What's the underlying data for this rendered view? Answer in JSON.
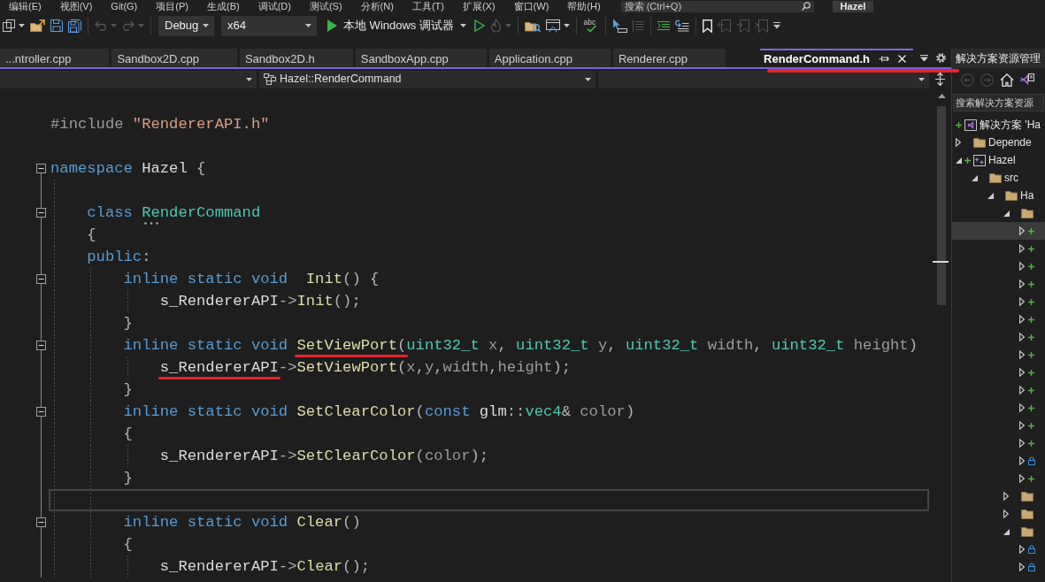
{
  "menu_bar": {
    "items": [
      "编辑(E)",
      "视图(V)",
      "Git(G)",
      "项目(P)",
      "生成(B)",
      "调试(D)",
      "测试(S)",
      "分析(N)",
      "工具(T)",
      "扩展(X)",
      "窗口(W)",
      "帮助(H)"
    ],
    "search": {
      "placeholder": "搜索 (Ctrl+Q)"
    },
    "solution_name": "Hazel"
  },
  "toolbar": [
    {
      "kind": "new",
      "disabled": false,
      "menu": true
    },
    {
      "kind": "open",
      "disabled": false,
      "menu": false
    },
    {
      "kind": "save",
      "disabled": false,
      "menu": false
    },
    {
      "kind": "save-all",
      "disabled": false,
      "menu": false
    },
    {
      "kind": "separator"
    },
    {
      "kind": "undo",
      "disabled": true,
      "menu": true
    },
    {
      "kind": "redo",
      "disabled": true,
      "menu": true
    },
    {
      "kind": "separator"
    },
    {
      "kind": "dropdown",
      "value": "Debug"
    },
    {
      "kind": "dropdown",
      "value": "x64"
    },
    {
      "kind": "run",
      "label": "本地 Windows 调试器",
      "menu": true
    },
    {
      "kind": "run-plain",
      "disabled": false,
      "menu": false
    },
    {
      "kind": "hot-reload",
      "disabled": true,
      "menu": true
    },
    {
      "kind": "separator"
    },
    {
      "kind": "find",
      "disabled": false,
      "menu": false
    },
    {
      "kind": "window",
      "disabled": false,
      "menu": true
    },
    {
      "kind": "separator"
    },
    {
      "kind": "spell",
      "text": "abc",
      "disabled": false,
      "menu": false
    },
    {
      "kind": "separator"
    },
    {
      "kind": "select",
      "disabled": false,
      "menu": false
    },
    {
      "kind": "lines",
      "disabled": true,
      "menu": false
    },
    {
      "kind": "separator"
    },
    {
      "kind": "indent",
      "disabled": false,
      "menu": false
    },
    {
      "kind": "wrap",
      "disabled": false,
      "menu": false
    },
    {
      "kind": "separator"
    },
    {
      "kind": "bookmark",
      "disabled": false,
      "menu": false
    },
    {
      "kind": "bookmark-prev",
      "disabled": true,
      "menu": false
    },
    {
      "kind": "bookmark-next",
      "disabled": true,
      "menu": false
    },
    {
      "kind": "bookmark-clear",
      "disabled": true,
      "menu": false
    },
    {
      "kind": "overflow"
    }
  ],
  "tabs": [
    {
      "label": "...ntroller.cpp",
      "selected": false,
      "underlined": false
    },
    {
      "label": "Sandbox2D.cpp",
      "selected": false,
      "underlined": false
    },
    {
      "label": "Sandbox2D.h",
      "selected": false,
      "underlined": false
    },
    {
      "label": "SandboxApp.cpp",
      "selected": false,
      "underlined": false
    },
    {
      "label": "Application.cpp",
      "selected": false,
      "underlined": false
    },
    {
      "label": "Renderer.cpp",
      "selected": false,
      "underlined": false
    },
    {
      "label": "RenderCommand.h",
      "selected": true,
      "underlined": true
    }
  ],
  "navigation_bar": {
    "class_dropdown": {
      "value": "Hazel::RenderCommand"
    }
  },
  "editor": {
    "lines": [
      {
        "collapsible": false,
        "current": false,
        "tokens": [
          {
            "kind": "preprocessor",
            "text": "#include "
          },
          {
            "kind": "string",
            "text": "\"RendererAPI.h\""
          }
        ]
      },
      {
        "collapsible": false,
        "current": false
      },
      {
        "collapsible": true,
        "current": false,
        "tokens": [
          {
            "kind": "keyword",
            "text": "namespace"
          },
          {
            "kind": "plain",
            "text": " Hazel "
          },
          {
            "kind": "punct",
            "text": "{"
          }
        ]
      },
      {
        "collapsible": false,
        "current": false
      },
      {
        "collapsible": true,
        "current": false,
        "tokens": [
          {
            "kind": "keyword",
            "text": "    class "
          },
          {
            "kind": "suggested",
            "text": "RenderCommand"
          }
        ]
      },
      {
        "collapsible": false,
        "current": false,
        "tokens": [
          {
            "kind": "punct",
            "text": "    {"
          }
        ]
      },
      {
        "collapsible": false,
        "current": false,
        "tokens": [
          {
            "kind": "keyword",
            "text": "    public"
          },
          {
            "kind": "punct",
            "text": ":"
          }
        ]
      },
      {
        "collapsible": true,
        "current": false,
        "tokens": [
          {
            "kind": "keyword",
            "text": "        inline static void  "
          },
          {
            "kind": "function",
            "text": "Init"
          },
          {
            "kind": "punct",
            "text": "() {"
          }
        ]
      },
      {
        "collapsible": false,
        "current": false,
        "tokens": [
          {
            "kind": "plain",
            "text": "            s_RendererAPI"
          },
          {
            "kind": "punct",
            "text": "->"
          },
          {
            "kind": "function",
            "text": "Init"
          },
          {
            "kind": "punct",
            "text": "();"
          }
        ]
      },
      {
        "collapsible": false,
        "current": false,
        "tokens": [
          {
            "kind": "punct",
            "text": "        }"
          }
        ]
      },
      {
        "collapsible": true,
        "current": false,
        "tokens": [
          {
            "kind": "keyword",
            "text": "        inline static void "
          },
          {
            "kind": "function",
            "text": "SetViewPort",
            "underlined": true
          },
          {
            "kind": "punct",
            "text": "(",
            "underlined": true
          },
          {
            "kind": "type",
            "text": "uint32_t"
          },
          {
            "kind": "param",
            "text": " x"
          },
          {
            "kind": "punct",
            "text": ", "
          },
          {
            "kind": "type",
            "text": "uint32_t"
          },
          {
            "kind": "param",
            "text": " y"
          },
          {
            "kind": "punct",
            "text": ", "
          },
          {
            "kind": "type",
            "text": "uint32_t"
          },
          {
            "kind": "param",
            "text": " width"
          },
          {
            "kind": "punct",
            "text": ", "
          },
          {
            "kind": "type",
            "text": "uint32_t"
          },
          {
            "kind": "param",
            "text": " height"
          },
          {
            "kind": "punct",
            "text": ")"
          }
        ]
      },
      {
        "collapsible": false,
        "current": false,
        "tokens": [
          {
            "kind": "plain",
            "text": "            s_RendererAPI",
            "underlined": true
          },
          {
            "kind": "punct",
            "text": "->"
          },
          {
            "kind": "function",
            "text": "SetViewPort"
          },
          {
            "kind": "punct",
            "text": "("
          },
          {
            "kind": "param",
            "text": "x"
          },
          {
            "kind": "punct",
            "text": ","
          },
          {
            "kind": "param",
            "text": "y"
          },
          {
            "kind": "punct",
            "text": ","
          },
          {
            "kind": "param",
            "text": "width"
          },
          {
            "kind": "punct",
            "text": ","
          },
          {
            "kind": "param",
            "text": "height"
          },
          {
            "kind": "punct",
            "text": ");"
          }
        ]
      },
      {
        "collapsible": false,
        "current": false,
        "tokens": [
          {
            "kind": "punct",
            "text": "        }"
          }
        ]
      },
      {
        "collapsible": true,
        "current": false,
        "tokens": [
          {
            "kind": "keyword",
            "text": "        inline static void "
          },
          {
            "kind": "function",
            "text": "SetClearColor"
          },
          {
            "kind": "punct",
            "text": "("
          },
          {
            "kind": "keyword",
            "text": "const"
          },
          {
            "kind": "plain",
            "text": " glm"
          },
          {
            "kind": "punct",
            "text": "::"
          },
          {
            "kind": "type",
            "text": "vec4"
          },
          {
            "kind": "punct",
            "text": "& "
          },
          {
            "kind": "param",
            "text": "color"
          },
          {
            "kind": "punct",
            "text": ")"
          }
        ]
      },
      {
        "collapsible": false,
        "current": false,
        "tokens": [
          {
            "kind": "punct",
            "text": "        {"
          }
        ]
      },
      {
        "collapsible": false,
        "current": false,
        "tokens": [
          {
            "kind": "plain",
            "text": "            s_RendererAPI"
          },
          {
            "kind": "punct",
            "text": "->"
          },
          {
            "kind": "function",
            "text": "SetClearColor"
          },
          {
            "kind": "punct",
            "text": "("
          },
          {
            "kind": "param",
            "text": "color"
          },
          {
            "kind": "punct",
            "text": ");"
          }
        ]
      },
      {
        "collapsible": false,
        "current": false,
        "tokens": [
          {
            "kind": "punct",
            "text": "        }"
          }
        ]
      },
      {
        "collapsible": false,
        "current": true
      },
      {
        "collapsible": true,
        "current": false,
        "tokens": [
          {
            "kind": "keyword",
            "text": "        inline static void "
          },
          {
            "kind": "function",
            "text": "Clear"
          },
          {
            "kind": "punct",
            "text": "()"
          }
        ]
      },
      {
        "collapsible": false,
        "current": false,
        "tokens": [
          {
            "kind": "punct",
            "text": "        {"
          }
        ]
      },
      {
        "collapsible": false,
        "current": false,
        "tokens": [
          {
            "kind": "plain",
            "text": "            s_RendererAPI"
          },
          {
            "kind": "punct",
            "text": "->"
          },
          {
            "kind": "function",
            "text": "Clear"
          },
          {
            "kind": "punct",
            "text": "();"
          }
        ]
      }
    ]
  },
  "solution_explorer": {
    "title": "解决方案资源管理",
    "nav_buttons": [
      {
        "kind": "back",
        "disabled": true
      },
      {
        "kind": "forward",
        "disabled": true
      },
      {
        "kind": "home",
        "disabled": false
      },
      {
        "kind": "switch-views",
        "disabled": false
      }
    ],
    "search": {
      "placeholder": "搜索解决方案资源"
    },
    "tree": [
      {
        "kind": "solution",
        "added": true,
        "locked": false,
        "label": "解决方案 'Ha",
        "selected": false,
        "children": [
          {
            "kind": "folder",
            "added": false,
            "locked": false,
            "label": "Depende",
            "expanded": false,
            "selected": false
          },
          {
            "kind": "project",
            "added": true,
            "locked": false,
            "label": "Hazel",
            "expanded": true,
            "selected": false,
            "children": [
              {
                "kind": "folder",
                "added": false,
                "locked": false,
                "label": "src",
                "expanded": true,
                "selected": false,
                "children": [
                  {
                    "kind": "folder",
                    "added": false,
                    "locked": false,
                    "label": "Ha",
                    "expanded": true,
                    "selected": false,
                    "children": [
                      {
                        "kind": "folder",
                        "added": false,
                        "locked": false,
                        "expanded": true,
                        "selected": false,
                        "children": [
                          {
                            "added": true,
                            "locked": false,
                            "expanded": false,
                            "selected": true
                          },
                          {
                            "added": true,
                            "locked": false,
                            "expanded": false,
                            "selected": false
                          },
                          {
                            "added": true,
                            "locked": false,
                            "expanded": false,
                            "selected": false
                          },
                          {
                            "added": true,
                            "locked": false,
                            "expanded": false,
                            "selected": false
                          },
                          {
                            "added": true,
                            "locked": false,
                            "expanded": false,
                            "selected": false
                          },
                          {
                            "added": true,
                            "locked": false,
                            "expanded": false,
                            "selected": false
                          },
                          {
                            "added": true,
                            "locked": false,
                            "expanded": false,
                            "selected": false
                          },
                          {
                            "added": true,
                            "locked": false,
                            "expanded": false,
                            "selected": false
                          },
                          {
                            "added": true,
                            "locked": false,
                            "expanded": false,
                            "selected": false
                          },
                          {
                            "added": true,
                            "locked": false,
                            "expanded": false,
                            "selected": false
                          },
                          {
                            "added": true,
                            "locked": false,
                            "expanded": false,
                            "selected": false
                          },
                          {
                            "added": true,
                            "locked": false,
                            "expanded": false,
                            "selected": false
                          },
                          {
                            "added": true,
                            "locked": false,
                            "expanded": false,
                            "selected": false
                          },
                          {
                            "added": false,
                            "locked": true,
                            "expanded": false,
                            "selected": false
                          },
                          {
                            "added": true,
                            "locked": false,
                            "expanded": false,
                            "selected": false
                          }
                        ]
                      },
                      {
                        "kind": "folder",
                        "added": false,
                        "locked": false,
                        "expanded": false,
                        "selected": false
                      },
                      {
                        "kind": "folder",
                        "added": false,
                        "locked": false,
                        "expanded": false,
                        "selected": false
                      },
                      {
                        "kind": "folder",
                        "added": false,
                        "locked": false,
                        "expanded": true,
                        "selected": false,
                        "children": [
                          {
                            "added": false,
                            "locked": true,
                            "expanded": false,
                            "selected": false
                          },
                          {
                            "added": false,
                            "locked": true,
                            "expanded": false,
                            "selected": false
                          }
                        ]
                      }
                    ]
                  }
                ]
              }
            ]
          }
        ]
      }
    ]
  }
}
